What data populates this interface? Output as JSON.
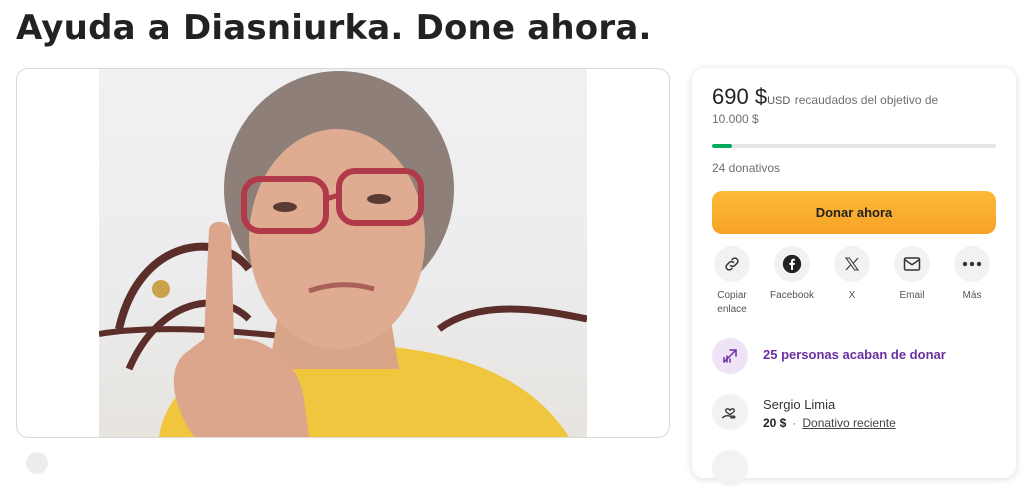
{
  "page": {
    "title": "Ayuda a Diasniurka. Done ahora."
  },
  "campaign": {
    "amount_raised": "690 $",
    "currency": "USD",
    "goal_text": "recaudados del objetivo de 10.000 $",
    "progress_fraction": 0.069,
    "donations_count": "24 donativos",
    "donate_label": "Donar ahora",
    "accent_color": "#02a95c",
    "button_color": "#f7a325"
  },
  "share": [
    {
      "label": "Copiar enlace",
      "icon": "link-icon"
    },
    {
      "label": "Facebook",
      "icon": "facebook-icon"
    },
    {
      "label": "X",
      "icon": "x-icon"
    },
    {
      "label": "Email",
      "icon": "email-icon"
    },
    {
      "label": "Más",
      "icon": "more-icon"
    }
  ],
  "recent_activity": {
    "text": "25 personas acaban de donar",
    "icon": "trending-up-icon",
    "color": "#6a2fa0"
  },
  "donors": [
    {
      "name": "Sergio Limia",
      "amount": "20 $",
      "tag": "Donativo reciente",
      "icon": "donation-hand-icon"
    }
  ]
}
